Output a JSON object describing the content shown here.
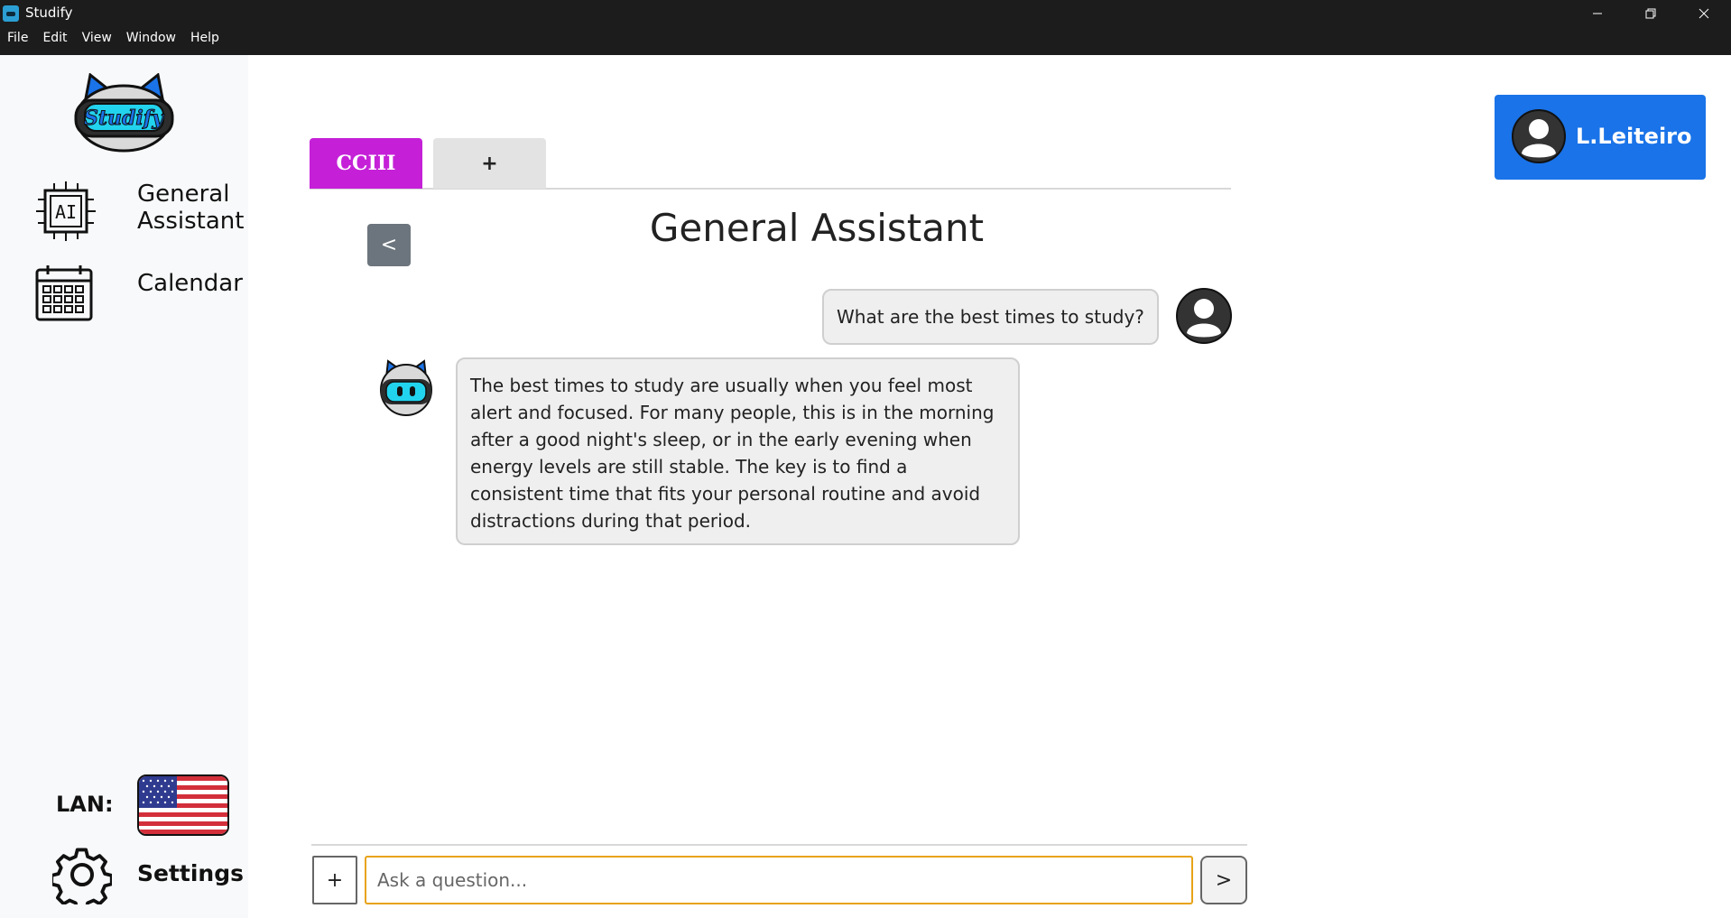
{
  "window": {
    "title": "Studify",
    "menu": [
      "File",
      "Edit",
      "View",
      "Window",
      "Help"
    ]
  },
  "sidebar": {
    "logo_text": "Studify",
    "items": [
      {
        "label": "General Assistant",
        "icon": "ai-chip-icon"
      },
      {
        "label": "Calendar",
        "icon": "calendar-icon"
      }
    ],
    "lan_label": "LAN:",
    "language_flag": "us-flag-icon",
    "settings_label": "Settings"
  },
  "tabs": [
    {
      "label": "CCIII",
      "active": true
    },
    {
      "label": "+",
      "active": false
    }
  ],
  "user": {
    "name": "L.Leiteiro"
  },
  "chat": {
    "back_label": "<",
    "title": "General Assistant",
    "messages": [
      {
        "role": "user",
        "text": "What are the best times to study?"
      },
      {
        "role": "assistant",
        "text": "The best times to study are usually when you feel most alert and focused. For many people, this is in the morning after a good night's sleep, or in the early evening when energy levels are still stable. The key is to find a consistent time that fits your personal routine and avoid distractions during that period."
      }
    ],
    "attach_label": "+",
    "input_placeholder": "Ask a question...",
    "input_value": "",
    "send_label": ">"
  },
  "colors": {
    "active_tab": "#c520d8",
    "user_badge": "#1a73e8",
    "back_button": "#6c757d",
    "input_border": "#e8a317"
  }
}
